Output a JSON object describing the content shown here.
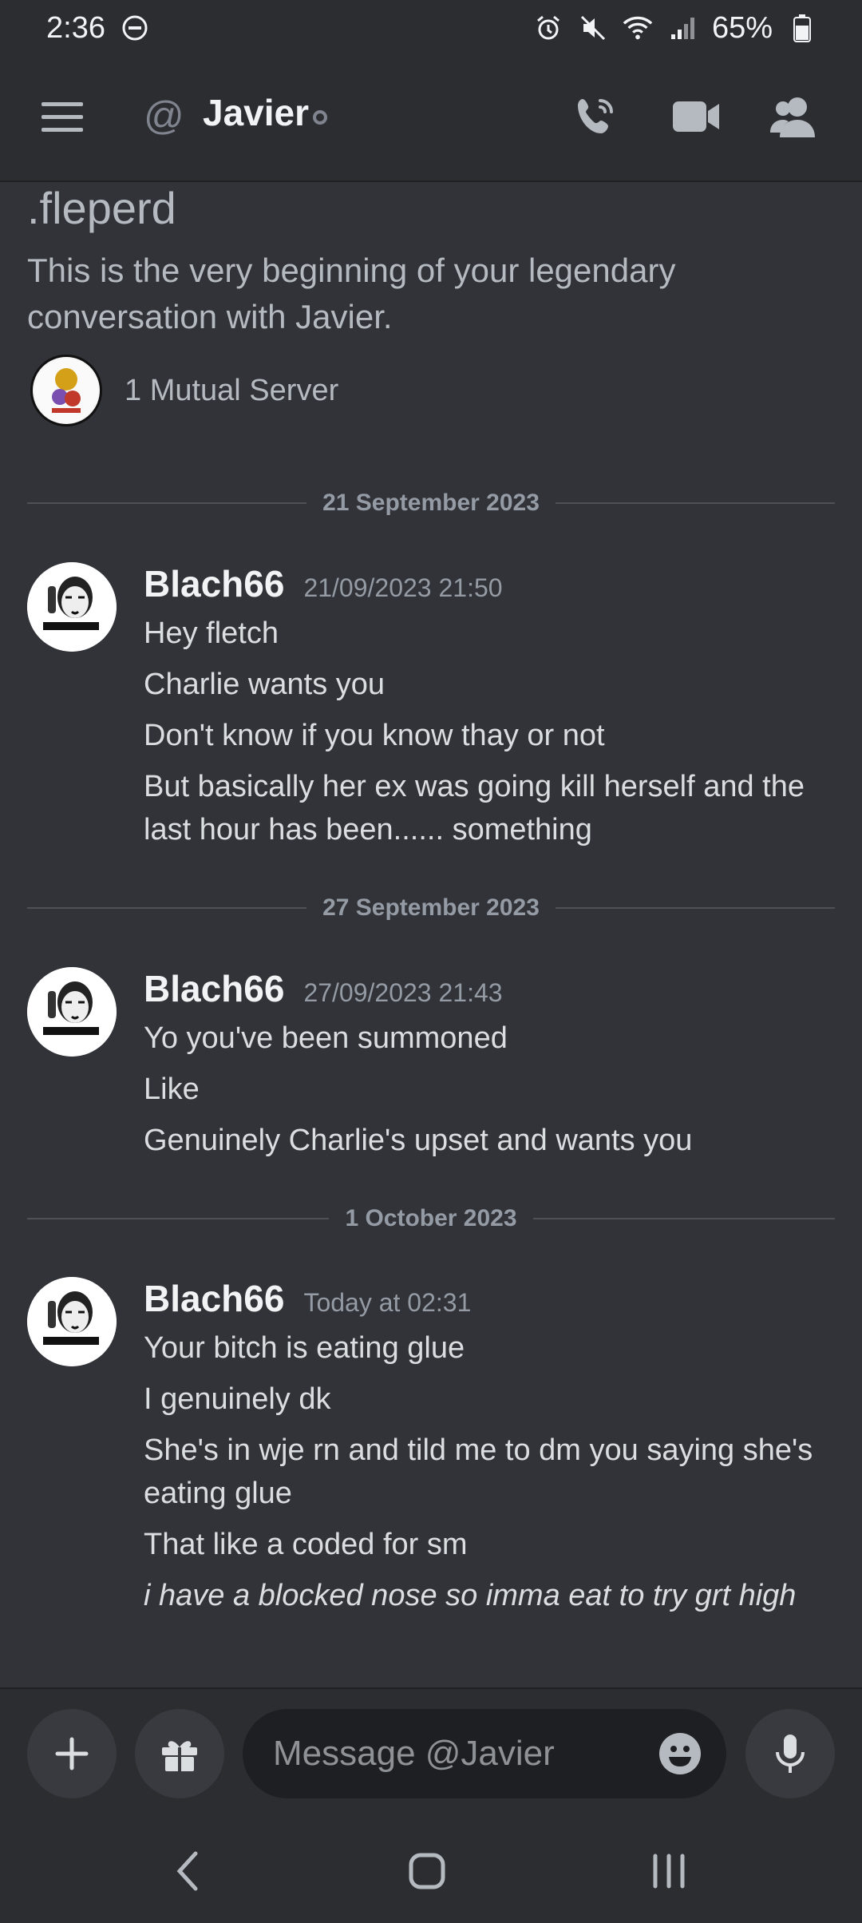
{
  "status_bar": {
    "time": "2:36",
    "battery": "65%"
  },
  "header": {
    "name": "Javier",
    "at_symbol": "@"
  },
  "intro": {
    "handle": ".fleperd",
    "text": "This is the very beginning of your legendary conversation with Javier.",
    "mutual_servers": "1 Mutual Server"
  },
  "dividers": [
    "21 September 2023",
    "27 September 2023",
    "1 October 2023"
  ],
  "groups": [
    {
      "author": "Blach66",
      "timestamp": "21/09/2023 21:50",
      "messages": [
        "Hey fletch",
        "Charlie wants you",
        "Don't know if you know thay or not",
        "But basically her ex was going kill herself and the last hour has been...... something"
      ]
    },
    {
      "author": "Blach66",
      "timestamp": "27/09/2023 21:43",
      "messages": [
        "Yo you've been summoned",
        "Like",
        "Genuinely Charlie's upset and wants you"
      ]
    },
    {
      "author": "Blach66",
      "timestamp": "Today at 02:31",
      "messages": [
        "Your bitch is eating glue",
        "I genuinely dk",
        "She's in wje rn and tild me to dm you saying she's eating glue",
        "That like a coded for sm",
        "i have a blocked nose so imma eat to try grt high"
      ]
    }
  ],
  "composer": {
    "placeholder": "Message @Javier"
  },
  "icons": {
    "menu": "hamburger-icon",
    "call": "phone-call-icon",
    "video": "video-camera-icon",
    "profile": "user-profile-icon",
    "add": "plus-icon",
    "gift": "gift-icon",
    "emoji": "emoji-icon",
    "mic": "microphone-icon"
  },
  "colors": {
    "background": "#313338",
    "header": "#2b2d31",
    "text": "#dbdee1",
    "muted": "#949ba4"
  }
}
